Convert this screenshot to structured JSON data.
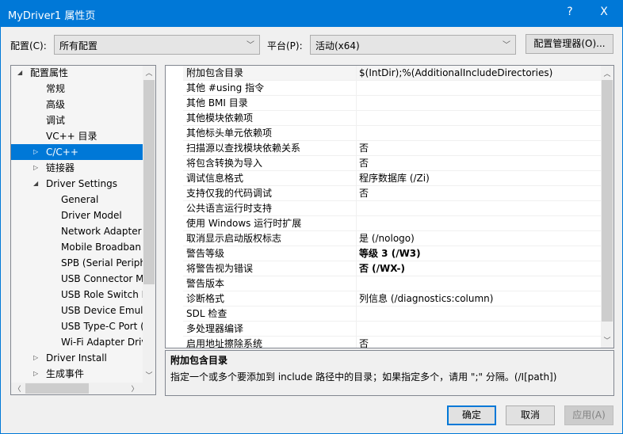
{
  "window": {
    "title": "MyDriver1 属性页",
    "help": "?",
    "close": "X",
    "accent": "#0078d7"
  },
  "toolbar": {
    "config_label": "配置(C):",
    "config_value": "所有配置",
    "platform_label": "平台(P):",
    "platform_value": "活动(x64)",
    "config_manager": "配置管理器(O)..."
  },
  "tree": {
    "items": [
      {
        "label": "配置属性",
        "level": 0,
        "state": "expanded"
      },
      {
        "label": "常规",
        "level": 1
      },
      {
        "label": "高级",
        "level": 1
      },
      {
        "label": "调试",
        "level": 1
      },
      {
        "label": "VC++ 目录",
        "level": 1
      },
      {
        "label": "C/C++",
        "level": 1,
        "state": "collapsed",
        "selected": true
      },
      {
        "label": "链接器",
        "level": 1,
        "state": "collapsed"
      },
      {
        "label": "Driver Settings",
        "level": 1,
        "state": "expanded"
      },
      {
        "label": "General",
        "level": 2
      },
      {
        "label": "Driver Model",
        "level": 2
      },
      {
        "label": "Network Adapter",
        "level": 2
      },
      {
        "label": "Mobile Broadban",
        "level": 2
      },
      {
        "label": "SPB (Serial Periph",
        "level": 2
      },
      {
        "label": "USB Connector M",
        "level": 2
      },
      {
        "label": "USB Role Switch D",
        "level": 2
      },
      {
        "label": "USB Device Emula",
        "level": 2
      },
      {
        "label": "USB Type-C Port (",
        "level": 2
      },
      {
        "label": "Wi-Fi Adapter Driv",
        "level": 2
      },
      {
        "label": "Driver Install",
        "level": 1,
        "state": "collapsed"
      },
      {
        "label": "生成事件",
        "level": 1,
        "state": "collapsed"
      }
    ]
  },
  "grid": {
    "rows": [
      {
        "name": "附加包含目录",
        "value": "$(IntDir);%(AdditionalIncludeDirectories)"
      },
      {
        "name": "其他 #using 指令",
        "value": ""
      },
      {
        "name": "其他 BMI 目录",
        "value": ""
      },
      {
        "name": "其他模块依赖项",
        "value": ""
      },
      {
        "name": "其他标头单元依赖项",
        "value": ""
      },
      {
        "name": "扫描源以查找模块依赖关系",
        "value": "否"
      },
      {
        "name": "将包含转换为导入",
        "value": "否"
      },
      {
        "name": "调试信息格式",
        "value": "程序数据库 (/Zi)"
      },
      {
        "name": "支持仅我的代码调试",
        "value": "否"
      },
      {
        "name": "公共语言运行时支持",
        "value": ""
      },
      {
        "name": "使用 Windows 运行时扩展",
        "value": ""
      },
      {
        "name": "取消显示启动版权标志",
        "value": "是 (/nologo)"
      },
      {
        "name": "警告等级",
        "value": "等级 3 (/W3)",
        "bold": true
      },
      {
        "name": "将警告视为错误",
        "value": "否 (/WX-)",
        "bold": true
      },
      {
        "name": "警告版本",
        "value": ""
      },
      {
        "name": "诊断格式",
        "value": "列信息 (/diagnostics:column)"
      },
      {
        "name": "SDL 检查",
        "value": ""
      },
      {
        "name": "多处理器编译",
        "value": ""
      },
      {
        "name": "启用地址擦除系统",
        "value": "否"
      }
    ]
  },
  "description": {
    "title": "附加包含目录",
    "text": "指定一个或多个要添加到 include 路径中的目录；如果指定多个，请用 \";\" 分隔。(/I[path])"
  },
  "buttons": {
    "ok": "确定",
    "cancel": "取消",
    "apply": "应用(A)"
  }
}
